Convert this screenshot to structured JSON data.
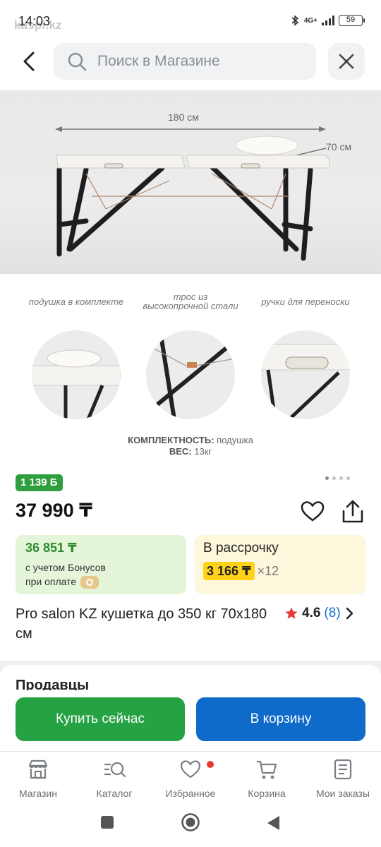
{
  "status_bar": {
    "time": "14:03",
    "watermark": "kaspi.kz",
    "network": "4G+",
    "battery": "59"
  },
  "search": {
    "placeholder": "Поиск в Магазине"
  },
  "product_image": {
    "dimension_length": "180 см",
    "dimension_width": "70 см",
    "features": [
      {
        "caption": "подушка в комплекте"
      },
      {
        "caption": "трос из высокопрочной стали"
      },
      {
        "caption": "ручки для переноски"
      }
    ],
    "spec_completeness_label": "КОМПЛЕКТНОСТЬ:",
    "spec_completeness_value": "подушка",
    "spec_weight_label": "ВЕС:",
    "spec_weight_value": "13кг",
    "pager": {
      "total": 4,
      "active_index": 0
    }
  },
  "bonus_badge": "1 139 Б",
  "price": "37 990 ₸",
  "bonus_card": {
    "price": "36 851 ₸",
    "line1": "с учетом Бонусов",
    "line2": "при оплате"
  },
  "installment_card": {
    "title": "В рассрочку",
    "monthly": "3 166 ₸",
    "months": "×12"
  },
  "product": {
    "title": "Pro salon KZ кушетка до 350 кг 70х180 см",
    "rating": "4.6",
    "reviews": "(8)"
  },
  "sellers": {
    "heading": "Продавцы"
  },
  "actions": {
    "buy_now": "Купить сейчас",
    "add_to_cart": "В корзину"
  },
  "bottom_nav": {
    "items": [
      {
        "label": "Магазин",
        "icon": "shop-icon"
      },
      {
        "label": "Каталог",
        "icon": "catalog-search-icon"
      },
      {
        "label": "Избранное",
        "icon": "heart-icon"
      },
      {
        "label": "Корзина",
        "icon": "cart-icon"
      },
      {
        "label": "Мои заказы",
        "icon": "orders-icon"
      }
    ]
  },
  "colors": {
    "bonus_green": "#2e9e3f",
    "buy_green": "#25a244",
    "cart_blue": "#0f6bc9",
    "installment_yellow": "#ffd21a",
    "rating_star": "#e53935"
  }
}
